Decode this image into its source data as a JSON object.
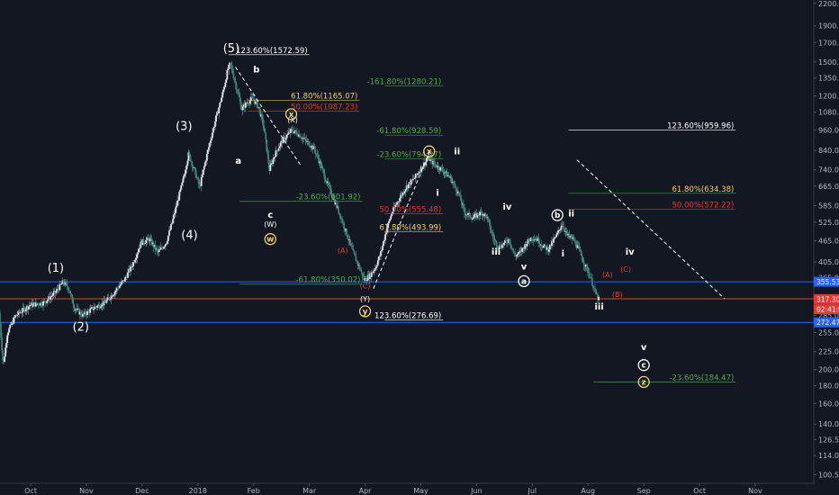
{
  "chart_data": {
    "type": "candlestick",
    "y_scale": "log",
    "y_range": [
      95,
      2250
    ],
    "y_ticks": [
      "2200.00",
      "1900.00",
      "1700.00",
      "1500.00",
      "1350.00",
      "1200.00",
      "1080.00",
      "960.00",
      "840.00",
      "740.00",
      "665.00",
      "585.00",
      "525.00",
      "465.00",
      "405.00",
      "365.00",
      "318.00",
      "285.00",
      "255.00",
      "225.00",
      "200.00",
      "180.00",
      "160.00",
      "140.00",
      "126.50",
      "114.00",
      "100.50"
    ],
    "y_tick_values": [
      2200,
      1900,
      1700,
      1500,
      1350,
      1200,
      1080,
      960,
      840,
      740,
      665,
      585,
      525,
      465,
      405,
      365,
      318,
      285,
      255,
      225,
      200,
      180,
      160,
      140,
      126.5,
      114,
      100.5
    ],
    "x_ticks": [
      "Oct",
      "Nov",
      "Dec",
      "2018",
      "Feb",
      "Mar",
      "Apr",
      "May",
      "Jun",
      "Jul",
      "Aug",
      "Sep",
      "Oct",
      "Nov"
    ],
    "x_tick_positions": [
      0.5,
      2.5,
      4.5,
      6.5,
      8.5,
      10.5,
      12.5,
      14.5,
      16.5,
      18.5,
      20.5,
      22.5,
      24.5,
      26.5
    ],
    "x_range": [
      -0.6,
      28.6
    ],
    "price_anchors": [
      [
        -0.6,
        290
      ],
      [
        -0.45,
        205
      ],
      [
        -0.3,
        255
      ],
      [
        0,
        285
      ],
      [
        0.5,
        305
      ],
      [
        1,
        310
      ],
      [
        1.4,
        330
      ],
      [
        1.7,
        355
      ],
      [
        1.9,
        340
      ],
      [
        2.1,
        300
      ],
      [
        2.4,
        285
      ],
      [
        2.8,
        300
      ],
      [
        3.2,
        310
      ],
      [
        3.5,
        330
      ],
      [
        3.9,
        360
      ],
      [
        4.2,
        400
      ],
      [
        4.5,
        460
      ],
      [
        4.8,
        470
      ],
      [
        5.1,
        430
      ],
      [
        5.4,
        460
      ],
      [
        5.6,
        520
      ],
      [
        5.8,
        600
      ],
      [
        6.0,
        690
      ],
      [
        6.2,
        820
      ],
      [
        6.4,
        740
      ],
      [
        6.6,
        660
      ],
      [
        6.8,
        780
      ],
      [
        7.0,
        910
      ],
      [
        7.2,
        1050
      ],
      [
        7.4,
        1200
      ],
      [
        7.5,
        1300
      ],
      [
        7.6,
        1420
      ],
      [
        7.7,
        1480
      ],
      [
        7.8,
        1380
      ],
      [
        7.9,
        1280
      ],
      [
        8.0,
        1200
      ],
      [
        8.1,
        1100
      ],
      [
        8.3,
        1150
      ],
      [
        8.5,
        1180
      ],
      [
        8.7,
        1120
      ],
      [
        8.9,
        980
      ],
      [
        9.1,
        740
      ],
      [
        9.3,
        820
      ],
      [
        9.5,
        880
      ],
      [
        9.7,
        920
      ],
      [
        9.9,
        960
      ],
      [
        10.1,
        940
      ],
      [
        10.3,
        910
      ],
      [
        10.5,
        880
      ],
      [
        10.7,
        850
      ],
      [
        10.9,
        780
      ],
      [
        11.1,
        700
      ],
      [
        11.3,
        640
      ],
      [
        11.6,
        560
      ],
      [
        11.9,
        480
      ],
      [
        12.1,
        430
      ],
      [
        12.3,
        395
      ],
      [
        12.5,
        360
      ],
      [
        12.7,
        370
      ],
      [
        12.9,
        390
      ],
      [
        13.1,
        430
      ],
      [
        13.3,
        500
      ],
      [
        13.5,
        560
      ],
      [
        13.7,
        600
      ],
      [
        14.0,
        660
      ],
      [
        14.3,
        700
      ],
      [
        14.6,
        760
      ],
      [
        14.8,
        800
      ],
      [
        15.0,
        770
      ],
      [
        15.3,
        740
      ],
      [
        15.6,
        700
      ],
      [
        15.9,
        630
      ],
      [
        16.1,
        560
      ],
      [
        16.4,
        540
      ],
      [
        16.7,
        560
      ],
      [
        16.9,
        545
      ],
      [
        17.1,
        480
      ],
      [
        17.3,
        445
      ],
      [
        17.5,
        455
      ],
      [
        17.7,
        470
      ],
      [
        17.9,
        420
      ],
      [
        18.1,
        430
      ],
      [
        18.3,
        455
      ],
      [
        18.5,
        475
      ],
      [
        18.7,
        470
      ],
      [
        18.9,
        450
      ],
      [
        19.1,
        440
      ],
      [
        19.4,
        480
      ],
      [
        19.6,
        520
      ],
      [
        19.8,
        480
      ],
      [
        20.0,
        470
      ],
      [
        20.2,
        440
      ],
      [
        20.4,
        400
      ],
      [
        20.6,
        370
      ],
      [
        20.8,
        330
      ],
      [
        20.9,
        317
      ]
    ],
    "horizontal_lines": [
      {
        "price": 355.53,
        "color": "#2962ff",
        "x_from": -0.6
      },
      {
        "price": 318.0,
        "color": "#c0522e",
        "x_from": -0.6
      },
      {
        "price": 272.47,
        "color": "#2962ff",
        "x_from": -0.6
      }
    ],
    "price_badges": [
      {
        "text": "355.53",
        "price": 355.53,
        "bg": "#2962ff"
      },
      {
        "text": "317.30",
        "price": 317.3,
        "bg": "#e53935"
      },
      {
        "text": "02:41:01",
        "price": 297,
        "bg": "#e53935"
      },
      {
        "text": "272.47",
        "price": 272.47,
        "bg": "#2962ff"
      }
    ],
    "fib_levels": [
      {
        "label": "123.60%(1572.59)",
        "price": 1572.59,
        "x1": 7.6,
        "x2": 10.5,
        "color": "#ffffff",
        "label_color": "#ffffff"
      },
      {
        "label": "61.80%(1165.07)",
        "price": 1165.07,
        "x1": 8.3,
        "x2": 12.3,
        "color": "#f0d264",
        "label_color": "#f0d264"
      },
      {
        "label": "50.00%(1087.23)",
        "price": 1087.23,
        "x1": 8.3,
        "x2": 12.3,
        "color": "#e53935",
        "label_color": "#e53935"
      },
      {
        "label": "-23.60%(601.92)",
        "price": 601.92,
        "x1": 8.0,
        "x2": 12.4,
        "color": "#4caf50",
        "label_color": "#4caf50"
      },
      {
        "label": "-61.80%(350.02)",
        "price": 350.02,
        "x1": 8.0,
        "x2": 12.4,
        "color": "#4caf50",
        "label_color": "#4caf50"
      },
      {
        "label": "-161.80%(1280.21)",
        "price": 1280.21,
        "x1": 13.2,
        "x2": 15.3,
        "color": "#4caf50",
        "label_color": "#4caf50"
      },
      {
        "label": "-61.80%(928.59)",
        "price": 928.59,
        "x1": 13.2,
        "x2": 15.3,
        "color": "#4caf50",
        "label_color": "#4caf50"
      },
      {
        "label": "-23.60%(794.27)",
        "price": 794.27,
        "x1": 13.2,
        "x2": 15.3,
        "color": "#4caf50",
        "label_color": "#4caf50"
      },
      {
        "label": "50.00%(555.48)",
        "price": 555.48,
        "x1": 13.2,
        "x2": 15.3,
        "color": "#e53935",
        "label_color": "#e53935"
      },
      {
        "label": "61.80%(493.99)",
        "price": 493.99,
        "x1": 13.2,
        "x2": 15.3,
        "color": "#f0d264",
        "label_color": "#f0d264"
      },
      {
        "label": "123.60%(276.69)",
        "price": 276.69,
        "x1": 13.2,
        "x2": 15.3,
        "color": "#ffffff",
        "label_color": "#ffffff"
      },
      {
        "label": "123.60%(959.96)",
        "price": 959.96,
        "x1": 19.8,
        "x2": 25.8,
        "color": "#ffffff",
        "label_color": "#ffffff"
      },
      {
        "label": "61.80%(634.38)",
        "price": 634.38,
        "x1": 19.8,
        "x2": 25.8,
        "color": "#4caf50",
        "label_color": "#f0d264"
      },
      {
        "label": "50.00%(572.22)",
        "price": 572.22,
        "x1": 19.8,
        "x2": 25.8,
        "color": "#e53935",
        "label_color": "#e53935"
      },
      {
        "label": "-23.60%(184.47)",
        "price": 184.47,
        "x1": 20.7,
        "x2": 25.8,
        "color": "#4caf50",
        "label_color": "#4caf50"
      }
    ],
    "trend_lines": [
      {
        "from": [
          7.85,
          1450
        ],
        "to": [
          10.2,
          760
        ],
        "color": "#ffffff",
        "dash": true
      },
      {
        "from": [
          12.8,
          340
        ],
        "to": [
          14.8,
          830
        ],
        "color": "#ffffff",
        "dash": true
      },
      {
        "from": [
          20.1,
          790
        ],
        "to": [
          25.4,
          318
        ],
        "color": "#ffffff",
        "dash": true
      }
    ],
    "wave_labels": [
      {
        "text": "(1)",
        "x": 1.4,
        "price": 380,
        "style": "big"
      },
      {
        "text": "(2)",
        "x": 2.3,
        "price": 258,
        "style": "big"
      },
      {
        "text": "(3)",
        "x": 6.0,
        "price": 960,
        "style": "big"
      },
      {
        "text": "(4)",
        "x": 6.2,
        "price": 470,
        "style": "big"
      },
      {
        "text": "(5)",
        "x": 7.7,
        "price": 1600,
        "style": "big"
      },
      {
        "text": "a",
        "x": 7.95,
        "price": 770,
        "style": "small"
      },
      {
        "text": "b",
        "x": 8.6,
        "price": 1400,
        "style": "small"
      },
      {
        "text": "c",
        "x": 9.1,
        "price": 540,
        "style": "small"
      },
      {
        "text": "(W)",
        "x": 9.1,
        "price": 510,
        "style": "tiny"
      },
      {
        "text": "(X)",
        "x": 9.9,
        "price": 1010,
        "style": "tiny"
      },
      {
        "text": "(A)",
        "x": 11.7,
        "price": 430,
        "style": "red"
      },
      {
        "text": "(C)",
        "x": 12.5,
        "price": 340,
        "style": "red"
      },
      {
        "text": "(Y)",
        "x": 12.5,
        "price": 312,
        "style": "tiny"
      },
      {
        "text": "i",
        "x": 15.1,
        "price": 625,
        "style": "small"
      },
      {
        "text": "ii",
        "x": 15.8,
        "price": 820,
        "style": "small"
      },
      {
        "text": "iii",
        "x": 17.2,
        "price": 425,
        "style": "small"
      },
      {
        "text": "iv",
        "x": 17.6,
        "price": 570,
        "style": "small"
      },
      {
        "text": "v",
        "x": 18.2,
        "price": 385,
        "style": "small"
      },
      {
        "text": "i",
        "x": 19.6,
        "price": 420,
        "style": "small"
      },
      {
        "text": "ii",
        "x": 19.9,
        "price": 545,
        "style": "small"
      },
      {
        "text": "iii",
        "x": 20.9,
        "price": 296,
        "style": "small"
      },
      {
        "text": "iv",
        "x": 22.0,
        "price": 425,
        "style": "small"
      },
      {
        "text": "v",
        "x": 22.5,
        "price": 227,
        "style": "small"
      },
      {
        "text": "(A)",
        "x": 21.2,
        "price": 366,
        "style": "red"
      },
      {
        "text": "(B)",
        "x": 21.55,
        "price": 322,
        "style": "red"
      },
      {
        "text": "(C)",
        "x": 21.85,
        "price": 380,
        "style": "red"
      }
    ],
    "circle_labels": [
      {
        "text": "x",
        "x": 9.85,
        "price": 1065,
        "color": "#f0d264"
      },
      {
        "text": "w",
        "x": 9.1,
        "price": 470,
        "color": "#f0d264"
      },
      {
        "text": "y",
        "x": 12.5,
        "price": 293,
        "color": "#f0d264"
      },
      {
        "text": "x",
        "x": 14.8,
        "price": 835,
        "color": "#f0d264"
      },
      {
        "text": "a",
        "x": 18.2,
        "price": 357,
        "color": "#ffffff"
      },
      {
        "text": "b",
        "x": 19.4,
        "price": 550,
        "color": "#ffffff"
      },
      {
        "text": "c",
        "x": 22.5,
        "price": 206,
        "color": "#ffffff"
      },
      {
        "text": "z",
        "x": 22.5,
        "price": 184.47,
        "color": "#f0d264"
      }
    ]
  }
}
